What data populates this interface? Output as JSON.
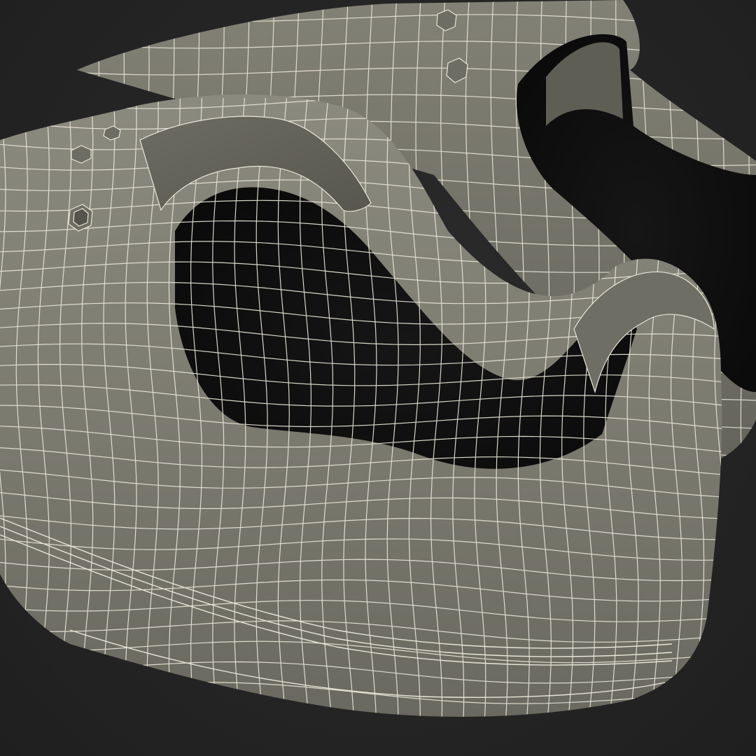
{
  "scene": {
    "subject": "sneakers-pair-wireframe",
    "colors": {
      "background": "#262626",
      "shell": "#7d7c70",
      "shell_light": "#8f8e82",
      "shell_dark": "#5f5e55",
      "interior": "#111111",
      "interior_mid": "#1c1c1c",
      "wire": "#e9e6d8"
    }
  }
}
